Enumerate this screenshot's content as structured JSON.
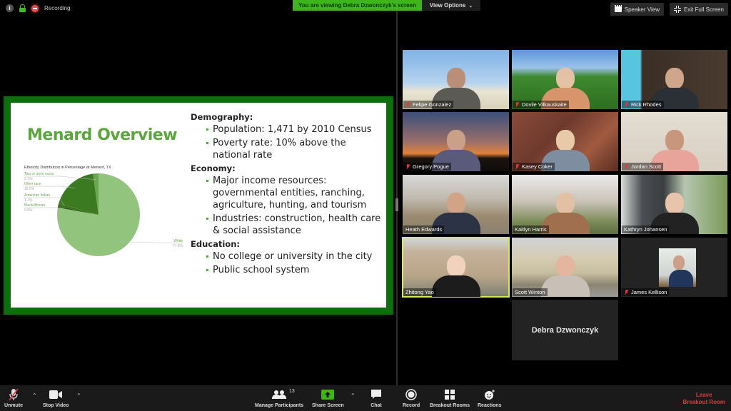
{
  "top_bar": {
    "recording_label": "Recording",
    "viewing_banner": "You are viewing Debra Dzwonczyk's screen",
    "view_options_label": "View Options",
    "speaker_view_label": "Speaker View",
    "exit_fullscreen_label": "Exit Full Screen",
    "colors": {
      "banner": "#3eb51a",
      "lock": "#3cbf1d",
      "recording": "#e84a4a"
    }
  },
  "slide": {
    "title": "Menard Overview",
    "sections": [
      {
        "heading": "Demography:",
        "bullets": [
          "Population: 1,471 by 2010 Census",
          "Poverty rate: 10% above the national rate"
        ]
      },
      {
        "heading": "Economy:",
        "bullets": [
          "Major income resources: governmental entities, ranching, agriculture, hunting, and tourism",
          "Industries: construction, health care & social assistance"
        ]
      },
      {
        "heading": "Education:",
        "bullets": [
          "No college or university in the city",
          "Public school system"
        ]
      }
    ]
  },
  "chart_data": {
    "type": "pie",
    "title": "Ethnicity Distribution in Percentage at Menard, TX",
    "slices": [
      {
        "label": "White",
        "value": 77.8,
        "display": "77.8%",
        "color": "#93c47d"
      },
      {
        "label": "Black/African",
        "value": 0.5,
        "display": "0.5%",
        "color": "#274e13"
      },
      {
        "label": "American Indian",
        "value": 1.1,
        "display": "1.1%",
        "color": "#38761d"
      },
      {
        "label": "Other race",
        "value": 18.5,
        "display": "18.5%",
        "color": "#3c7a22"
      },
      {
        "label": "Two or more races",
        "value": 2.1,
        "display": "2.1%",
        "color": "#6aa84f"
      }
    ],
    "legend": "callout-labels"
  },
  "participants": [
    {
      "name": "Felipe Gonzalez",
      "muted": true
    },
    {
      "name": "Dovile Vilkauskaite",
      "muted": true
    },
    {
      "name": "Rick Rhodes",
      "muted": true
    },
    {
      "name": "Gregory Pogue",
      "muted": true
    },
    {
      "name": "Kasey Coker",
      "muted": true
    },
    {
      "name": "Jordan Scott",
      "muted": true
    },
    {
      "name": "Heath Edwards",
      "muted": false
    },
    {
      "name": "Kaitlyn Harris",
      "muted": false
    },
    {
      "name": "Kathryn Johansen",
      "muted": false
    },
    {
      "name": "Zhitong Yao",
      "muted": false,
      "active_speaker": true
    },
    {
      "name": "Scott Winton",
      "muted": false
    },
    {
      "name": "James Kellison",
      "muted": true
    },
    {
      "name": "Debra Dzwonczyk",
      "video_off": true
    }
  ],
  "toolbar": {
    "unmute": "Unmute",
    "stop_video": "Stop Video",
    "manage_participants": "Manage Participants",
    "participant_count": "13",
    "share_screen": "Share Screen",
    "chat": "Chat",
    "record": "Record",
    "breakout_rooms": "Breakout Rooms",
    "reactions": "Reactions",
    "leave_line1": "Leave",
    "leave_line2": "Breakout Room",
    "colors": {
      "share": "#3eb51a",
      "leave": "#e0393e"
    }
  }
}
